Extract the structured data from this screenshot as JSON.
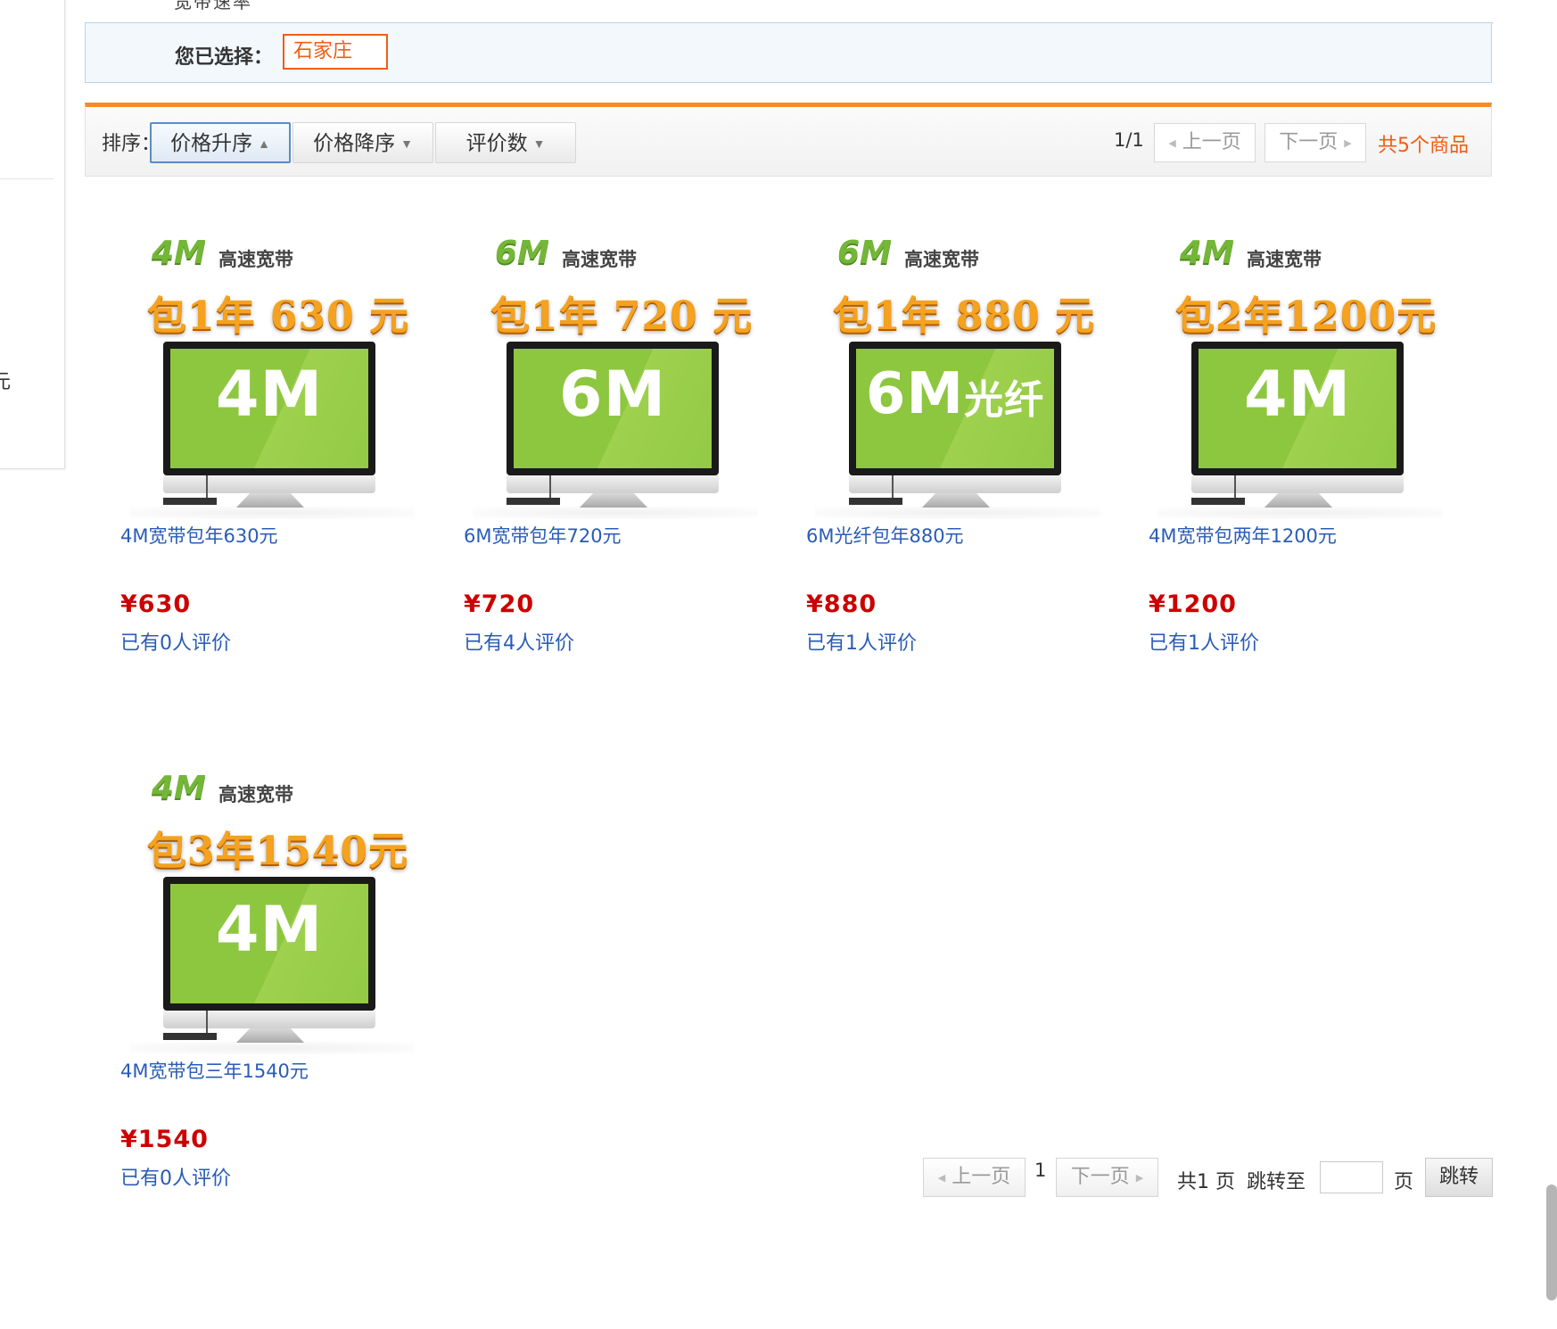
{
  "filter": {
    "cut_text": "宽带速率",
    "selected_label": "您已选择：",
    "selected_tag": "石家庄"
  },
  "sidebar": {
    "cut_char": "元"
  },
  "sort_bar": {
    "label": "排序：",
    "buttons": [
      {
        "label": "价格升序",
        "arrow": "▲",
        "active": true
      },
      {
        "label": "价格降序",
        "arrow": "▼",
        "active": false
      },
      {
        "label": "评价数",
        "arrow": "▼",
        "active": false
      }
    ],
    "page_info": "1/1",
    "prev_label": "上一页",
    "next_label": "下一页",
    "total_goods": "共5个商品"
  },
  "products": [
    {
      "speed": "4M",
      "speed_sub": "高速宽带",
      "banner": "包1年 630 元",
      "screen": "4M",
      "title": "4M宽带包年630元",
      "price": "¥630",
      "reviews": "已有0人评价"
    },
    {
      "speed": "6M",
      "speed_sub": "高速宽带",
      "banner": "包1年 720 元",
      "screen": "6M",
      "title": "6M宽带包年720元",
      "price": "¥720",
      "reviews": "已有4人评价"
    },
    {
      "speed": "6M",
      "speed_sub": "高速宽带",
      "banner": "包1年 880 元",
      "screen": "6M",
      "screen_suffix": "光纤",
      "title": "6M光纤包年880元",
      "price": "¥880",
      "reviews": "已有1人评价"
    },
    {
      "speed": "4M",
      "speed_sub": "高速宽带",
      "banner": "包2年1200元",
      "screen": "4M",
      "title": "4M宽带包两年1200元",
      "price": "¥1200",
      "reviews": "已有1人评价"
    },
    {
      "speed": "4M",
      "speed_sub": "高速宽带",
      "banner": "包3年1540元",
      "screen": "4M",
      "title": "4M宽带包三年1540元",
      "price": "¥1540",
      "reviews": "已有0人评价"
    }
  ],
  "bottom_pager": {
    "prev_label": "上一页",
    "current_page": "1",
    "next_label": "下一页",
    "total_pages": "共1 页",
    "jump_label": "跳转至",
    "page_unit": "页",
    "go_label": "跳转"
  }
}
